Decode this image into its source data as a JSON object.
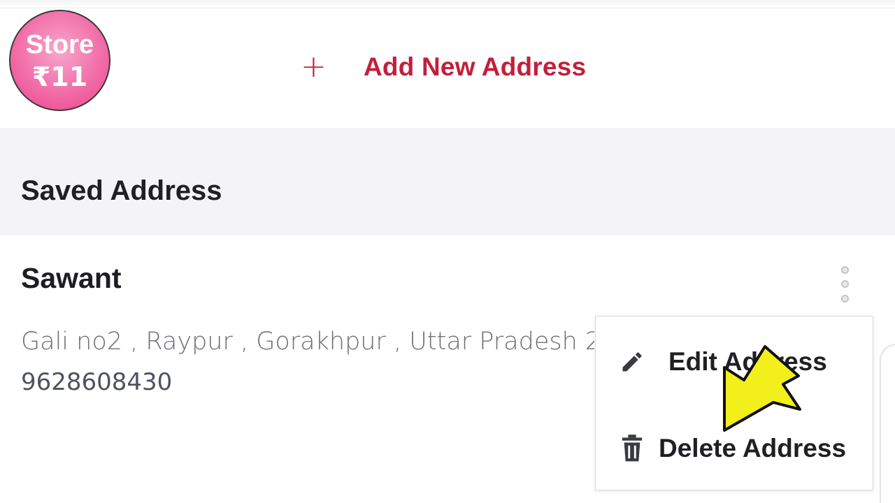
{
  "badge": {
    "line1": "Store",
    "line2": "₹11"
  },
  "add_address": {
    "icon": "plus-icon",
    "label": "Add New Address"
  },
  "saved_section": {
    "title": "Saved Address"
  },
  "address_card": {
    "name": "Sawant",
    "address_line": "Gali no2 , Raypur , Gorakhpur , Uttar Pradesh 2",
    "phone": "9628608430",
    "more_icon": "kebab-menu-icon"
  },
  "context_menu": {
    "items": [
      {
        "label": "Edit Address",
        "icon": "pencil-icon"
      },
      {
        "label": "Delete Address",
        "icon": "trash-icon"
      }
    ]
  },
  "annotation": {
    "icon": "arrow-pointer-icon",
    "color": "#f2ef1a"
  },
  "colors": {
    "accent": "#c21f3a",
    "badge_pink": "#ef5c9c",
    "header_bg": "#f4f4f6"
  }
}
